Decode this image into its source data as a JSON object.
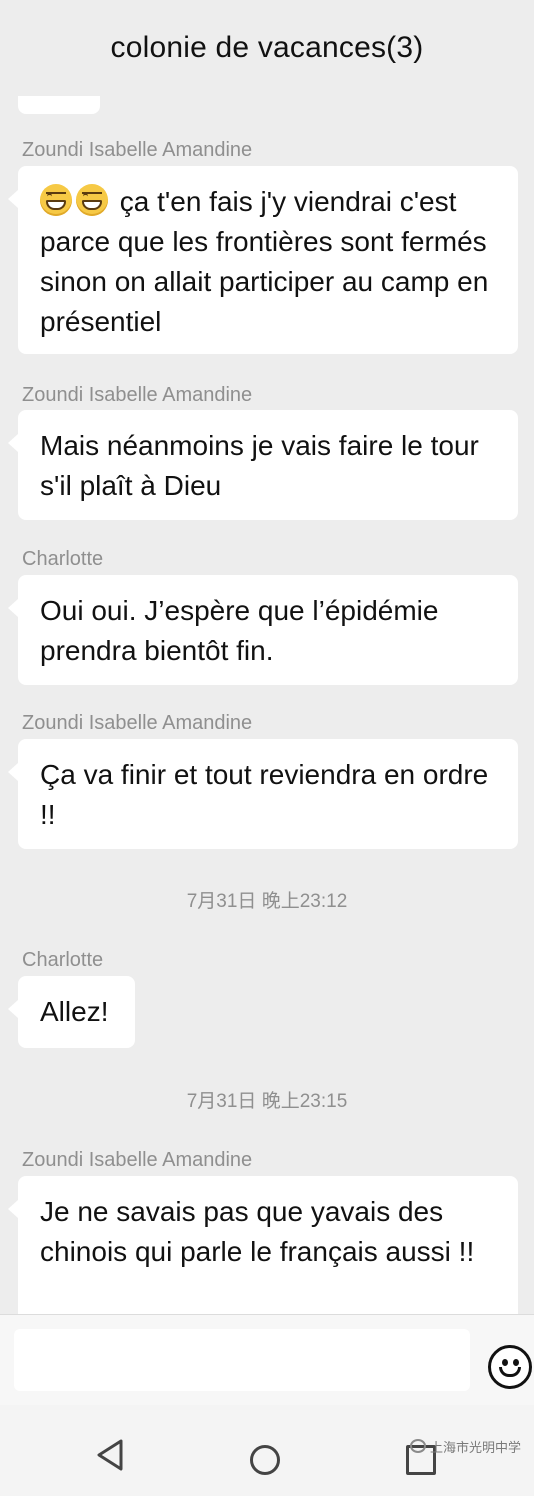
{
  "header": {
    "title": "colonie de vacances(3)"
  },
  "messages": [
    {
      "sender": "Zoundi Isabelle Amandine",
      "text": "ça t'en fais j'y viendrai c'est parce que les frontières sont fermés sinon on allait participer au camp en présentiel",
      "emoji_prefix": [
        "grinning-face-icon",
        "grinning-face-icon"
      ]
    },
    {
      "sender": "Zoundi Isabelle Amandine",
      "text": "Mais néanmoins je vais faire le tour s'il plaît à Dieu"
    },
    {
      "sender": "Charlotte",
      "text": "Oui oui. J’espère que l’épidémie prendra bientôt fin."
    },
    {
      "sender": "Zoundi Isabelle Amandine",
      "text": "Ça va finir et tout reviendra en ordre !!"
    },
    {
      "timestamp": "7月31日 晚上23:12"
    },
    {
      "sender": "Charlotte",
      "text": "Allez!"
    },
    {
      "timestamp": "7月31日 晚上23:15"
    },
    {
      "sender": "Zoundi Isabelle Amandine",
      "text": "Je ne savais pas que yavais des chinois qui parle le français aussi !!"
    }
  ],
  "input_bar": {
    "emoji_button_icon": "smiley-face-icon"
  },
  "nav": {
    "back_icon": "back-triangle-icon",
    "home_icon": "home-circle-icon",
    "recent_icon": "recent-square-icon"
  },
  "watermark": {
    "text": "上海市光明中学"
  },
  "colors": {
    "background": "#ededed",
    "bubble": "#ffffff",
    "meta_text": "#8f8f8f"
  }
}
